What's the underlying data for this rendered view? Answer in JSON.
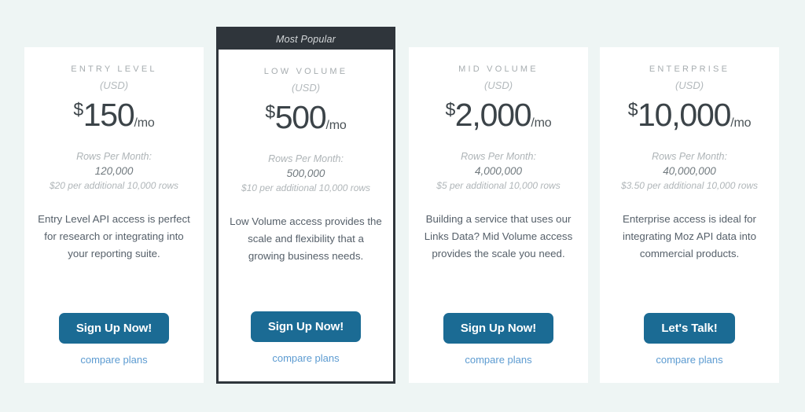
{
  "page": {
    "background_color": "#eef5f4",
    "accent_button_color": "#1b6b94",
    "link_color": "#5c9bd1",
    "featured_banner_color": "#2f353b"
  },
  "plans": [
    {
      "name": "ENTRY LEVEL",
      "currency_note": "(USD)",
      "currency_symbol": "$",
      "price": "150",
      "period": "/mo",
      "rows_label": "Rows Per Month:",
      "rows_value": "120,000",
      "rows_extra": "$20 per additional 10,000 rows",
      "description": "Entry Level API access is perfect for research or integrating into your reporting suite.",
      "cta_label": "Sign Up Now!",
      "compare_label": "compare plans",
      "featured": false,
      "badge": ""
    },
    {
      "name": "LOW VOLUME",
      "currency_note": "(USD)",
      "currency_symbol": "$",
      "price": "500",
      "period": "/mo",
      "rows_label": "Rows Per Month:",
      "rows_value": "500,000",
      "rows_extra": "$10 per additional 10,000 rows",
      "description": "Low Volume access provides the scale and flexibility that a growing business needs.",
      "cta_label": "Sign Up Now!",
      "compare_label": "compare plans",
      "featured": true,
      "badge": "Most Popular"
    },
    {
      "name": "MID VOLUME",
      "currency_note": "(USD)",
      "currency_symbol": "$",
      "price": "2,000",
      "period": "/mo",
      "rows_label": "Rows Per Month:",
      "rows_value": "4,000,000",
      "rows_extra": "$5 per additional 10,000 rows",
      "description": "Building a service that uses our Links Data? Mid Volume access provides the scale you need.",
      "cta_label": "Sign Up Now!",
      "compare_label": "compare plans",
      "featured": false,
      "badge": ""
    },
    {
      "name": "ENTERPRISE",
      "currency_note": "(USD)",
      "currency_symbol": "$",
      "price": "10,000",
      "period": "/mo",
      "rows_label": "Rows Per Month:",
      "rows_value": "40,000,000",
      "rows_extra": "$3.50 per additional 10,000 rows",
      "description": "Enterprise access is ideal for integrating Moz API data into commercial products.",
      "cta_label": "Let's Talk!",
      "compare_label": "compare plans",
      "featured": false,
      "badge": ""
    }
  ]
}
